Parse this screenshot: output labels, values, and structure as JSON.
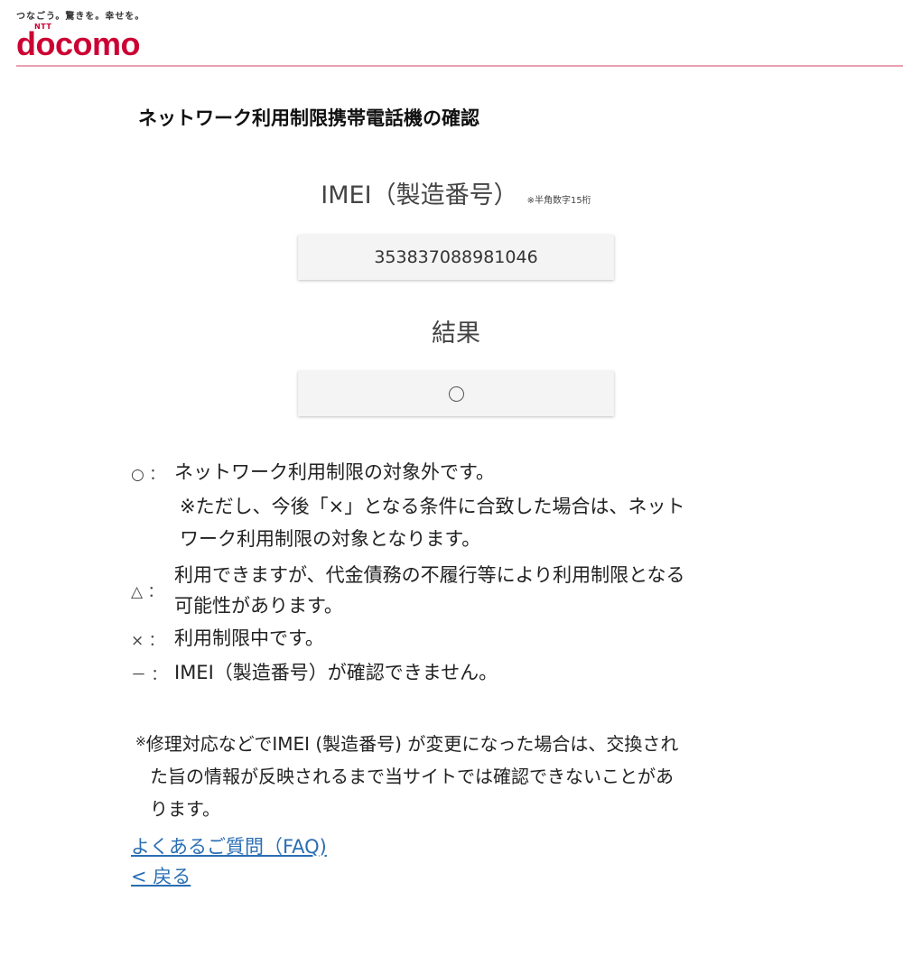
{
  "header": {
    "tagline": "つなごう。驚きを。幸せを。",
    "logo_ntt": "NTT",
    "logo_text": "docomo",
    "brand_color": "#cc0033"
  },
  "page_title": "ネットワーク利用制限携帯電話機の確認",
  "imei": {
    "label": "IMEI（製造番号）",
    "note": "※半角数字15桁",
    "value": "353837088981046"
  },
  "result": {
    "label": "結果",
    "value_icon": "circle-mark-icon"
  },
  "legend": [
    {
      "symbol": "○ ：",
      "text": "ネットワーク利用制限の対象外です。",
      "sub_lines": [
        "※ただし、今後「×」となる条件に合致した場合は、ネット",
        "ワーク利用制限の対象となります。"
      ]
    },
    {
      "symbol": "△ ：",
      "text_lines": [
        "利用できますが、代金債務の不履行等により利用制限となる",
        "可能性があります。"
      ]
    },
    {
      "symbol": "× ：",
      "text": "利用制限中です。"
    },
    {
      "symbol": "－ ：",
      "text": "IMEI（製造番号）が確認できません。"
    }
  ],
  "footnote": {
    "mark": "※",
    "line1": "修理対応などでIMEI (製造番号) が変更になった場合は、交換され",
    "line2": "た旨の情報が反映されるまで当サイトでは確認できないことがあ",
    "line3": "ります。"
  },
  "links": {
    "faq": "よくあるご質問（FAQ)",
    "back": "< 戻る",
    "link_color": "#2a6eb4"
  }
}
